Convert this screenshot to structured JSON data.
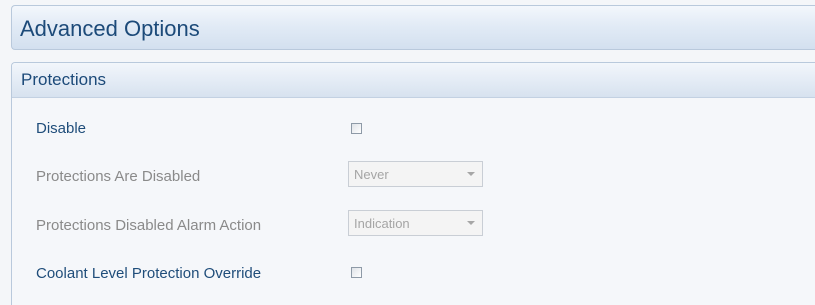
{
  "header": {
    "title": "Advanced Options"
  },
  "protections": {
    "title": "Protections",
    "disable": {
      "label": "Disable",
      "checked": false
    },
    "protections_are_disabled": {
      "label": "Protections Are Disabled",
      "value": "Never",
      "enabled": false
    },
    "protections_disabled_alarm_action": {
      "label": "Protections Disabled Alarm Action",
      "value": "Indication",
      "enabled": false
    },
    "coolant_level_protection_override": {
      "label": "Coolant Level Protection Override",
      "checked": false
    }
  },
  "colors": {
    "header_text": "#1c4a79",
    "enabled_label": "#1f4d7a",
    "disabled_label": "#8a8a8a",
    "panel_border": "#b9c9dc"
  },
  "icons": {
    "dropdown": "chevron-down-icon"
  }
}
